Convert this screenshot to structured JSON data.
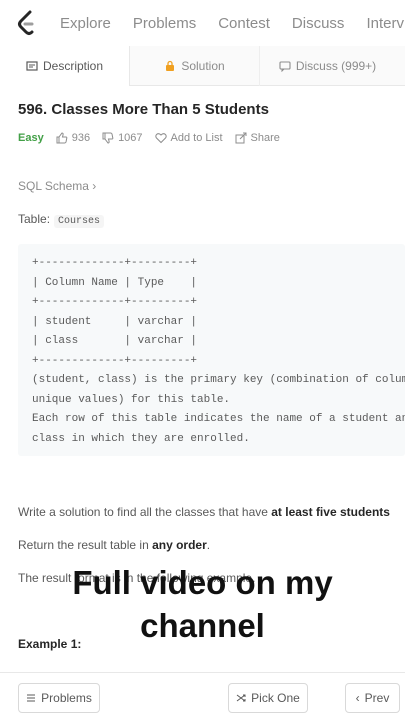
{
  "nav": {
    "links": [
      "Explore",
      "Problems",
      "Contest",
      "Discuss",
      "Interview"
    ]
  },
  "tabs": {
    "description": "Description",
    "solution": "Solution",
    "discuss": "Discuss (999+)"
  },
  "problem": {
    "title": "596. Classes More Than 5 Students",
    "difficulty": "Easy",
    "likes": "936",
    "dislikes": "1067",
    "add_to_list": "Add to List",
    "share": "Share",
    "schema_link": "SQL Schema ›",
    "table_label": "Table:",
    "table_name": "Courses",
    "code_lines": [
      "+-------------+---------+",
      "| Column Name | Type    |",
      "+-------------+---------+",
      "| student     | varchar |",
      "| class       | varchar |",
      "+-------------+---------+",
      "(student, class) is the primary key (combination of columns with",
      "unique values) for this table.",
      "Each row of this table indicates the name of a student and the",
      "class in which they are enrolled."
    ],
    "p1_pre": "Write a solution to find all the classes that have ",
    "p1_bold": "at least five students",
    "p2_pre": "Return the result table in ",
    "p2_bold": "any order",
    "p2_post": ".",
    "p3": "The result format is in the following example.",
    "example_heading": "Example 1:"
  },
  "overlay": {
    "line1": "Full video on my",
    "line2": "channel"
  },
  "bottom": {
    "problems": "Problems",
    "pick_one": "Pick One",
    "prev": "Prev"
  },
  "colors": {
    "easy": "#43a047",
    "text": "#262626",
    "muted": "#8c8c8c",
    "code_bg": "#f7f9fa"
  }
}
